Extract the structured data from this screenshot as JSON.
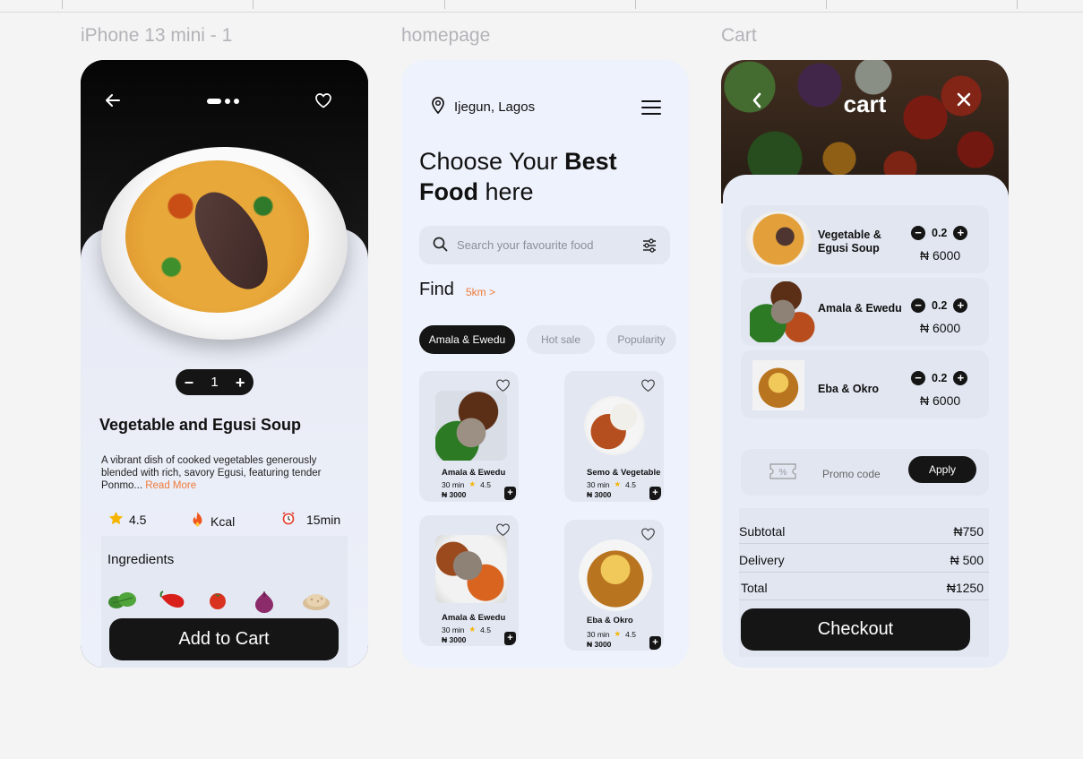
{
  "frames": {
    "detail_label": "iPhone 13 mini - 1",
    "home_label": "homepage",
    "cart_label": "Cart"
  },
  "detail": {
    "quantity": "1",
    "minus": "−",
    "plus": "+",
    "title": "Vegetable and Egusi Soup",
    "description": "A vibrant dish of cooked vegetables generously blended with rich, savory Egusi, featuring tender Ponmo...",
    "read_more": "Read More",
    "rating": "4.5",
    "kcal": "Kcal",
    "time": "15min",
    "ingredients_label": "Ingredients",
    "ingredients": [
      "vegetable-leaf-icon",
      "pepper-icon",
      "tomato-icon",
      "onion-icon",
      "egusi-seeds-icon"
    ],
    "cta": "Add to Cart"
  },
  "home": {
    "location": "Ijegun, Lagos",
    "headline_1": "Choose Your ",
    "headline_bold_1": "Best",
    "headline_bold_2": "Food",
    "headline_2": " here",
    "search_placeholder": "Search your favourite food",
    "find": "Find",
    "find_distance": "5km >",
    "chips": [
      "Amala & Ewedu",
      "Hot sale",
      "Popularity"
    ],
    "cards": [
      {
        "name": "Amala & Ewedu",
        "time": "30 min",
        "rating": "4.5",
        "price": "₦ 3000"
      },
      {
        "name": "Semo & Vegetable",
        "time": "30 min",
        "rating": "4.5",
        "price": "₦ 3000"
      },
      {
        "name": "Amala & Ewedu",
        "time": "30 min",
        "rating": "4.5",
        "price": "₦ 3000"
      },
      {
        "name": "Eba & Okro",
        "time": "30 min",
        "rating": "4.5",
        "price": "₦ 3000"
      }
    ]
  },
  "cart": {
    "title": "cart",
    "items": [
      {
        "name": "Vegetable & Egusi Soup",
        "qty": "0.2",
        "price": "₦ 6000"
      },
      {
        "name": "Amala & Ewedu",
        "qty": "0.2",
        "price": "₦ 6000"
      },
      {
        "name": "Eba & Okro",
        "qty": "0.2",
        "price": "₦ 6000"
      }
    ],
    "promo_label": "Promo code",
    "promo_icon_text": "%",
    "apply": "Apply",
    "subtotal_label": "Subtotal",
    "subtotal": "₦750",
    "delivery_label": "Delivery",
    "delivery": "₦ 500",
    "total_label": "Total",
    "total": "₦1250",
    "checkout": "Checkout"
  },
  "colors": {
    "accent": "#f07a3a",
    "dark": "#151515",
    "panel": "#eef2fb",
    "star": "#f5b400"
  }
}
